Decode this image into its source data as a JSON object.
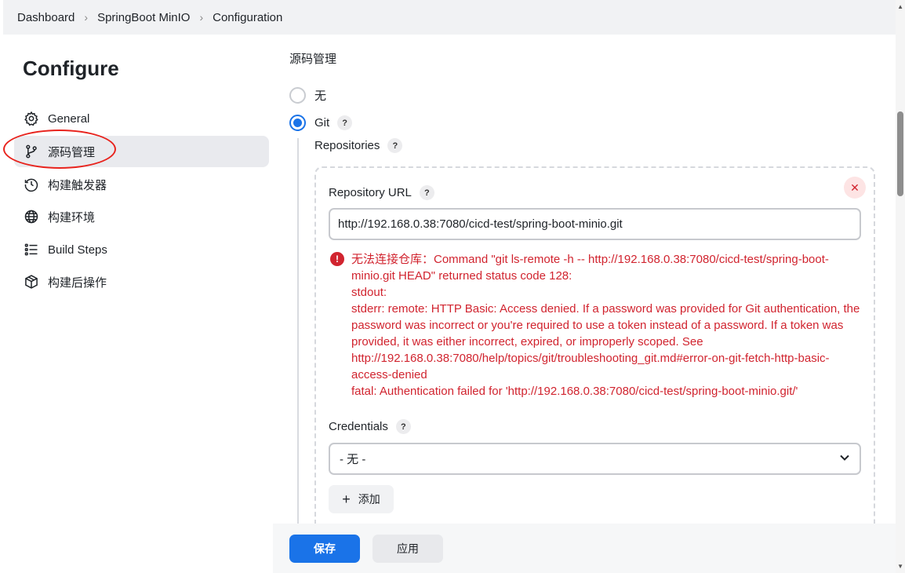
{
  "breadcrumb": {
    "items": [
      "Dashboard",
      "SpringBoot MinIO",
      "Configuration"
    ],
    "separator": "›"
  },
  "sidebar": {
    "title": "Configure",
    "items": [
      {
        "label": "General",
        "icon": "gear-icon"
      },
      {
        "label": "源码管理",
        "icon": "branch-icon",
        "active": true
      },
      {
        "label": "构建触发器",
        "icon": "clock-icon"
      },
      {
        "label": "构建环境",
        "icon": "globe-icon"
      },
      {
        "label": "Build Steps",
        "icon": "list-icon"
      },
      {
        "label": "构建后操作",
        "icon": "box-icon"
      }
    ]
  },
  "main": {
    "section_title": "源码管理",
    "scm_options": [
      {
        "label": "无",
        "selected": false
      },
      {
        "label": "Git",
        "selected": true
      }
    ],
    "help_mark": "?",
    "repositories_label": "Repositories",
    "repository_url_label": "Repository URL",
    "repository_url_value": "http://192.168.0.38:7080/cicd-test/spring-boot-minio.git",
    "error_message": "无法连接仓库：Command \"git ls-remote -h -- http://192.168.0.38:7080/cicd-test/spring-boot-minio.git HEAD\" returned status code 128:\nstdout:\nstderr: remote: HTTP Basic: Access denied. If a password was provided for Git authentication, the password was incorrect or you're required to use a token instead of a password. If a token was provided, it was either incorrect, expired, or improperly scoped. See http://192.168.0.38:7080/help/topics/git/troubleshooting_git.md#error-on-git-fetch-http-basic-access-denied\nfatal: Authentication failed for 'http://192.168.0.38:7080/cicd-test/spring-boot-minio.git/'",
    "credentials_label": "Credentials",
    "credentials_value": "- 无 -",
    "add_button": "添加",
    "close_symbol": "✕"
  },
  "footer": {
    "save_label": "保存",
    "apply_label": "应用"
  },
  "colors": {
    "primary": "#1a73e8",
    "error": "#d1242f",
    "annotation": "#e8231d"
  }
}
